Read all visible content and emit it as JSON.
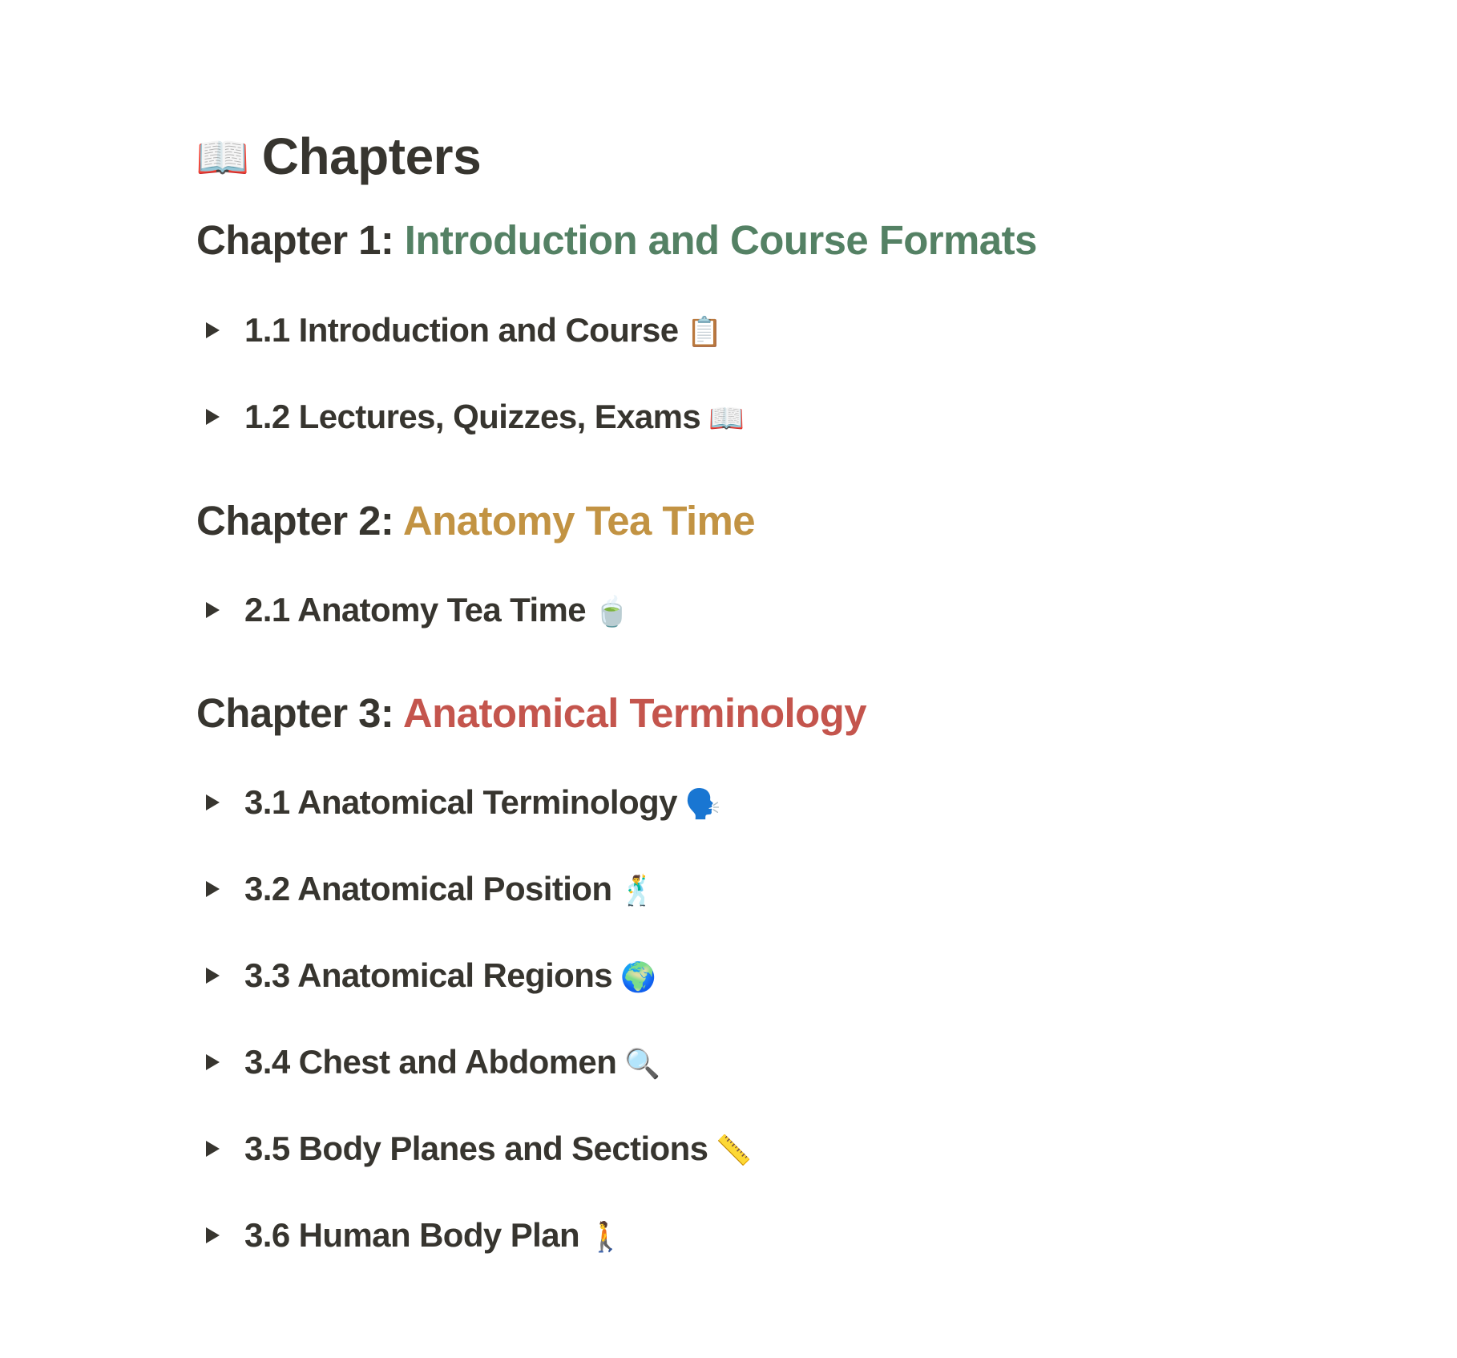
{
  "page": {
    "title": "Chapters",
    "title_icon": "📖",
    "title_icon_name": "open-book-icon"
  },
  "chapters": [
    {
      "prefix": "Chapter 1:  ",
      "name": "Introduction and Course Formats",
      "color": "#548164",
      "items": [
        {
          "label": "1.1 Introduction and Course",
          "emoji": "📋",
          "emoji_name": "clipboard-icon"
        },
        {
          "label": "1.2 Lectures, Quizzes, Exams",
          "emoji": "📖",
          "emoji_name": "open-book-icon"
        }
      ]
    },
    {
      "prefix": "Chapter 2: ",
      "name": "Anatomy Tea Time",
      "color": "#C29343",
      "items": [
        {
          "label": "2.1 Anatomy Tea Time",
          "emoji": "🍵",
          "emoji_name": "teacup-icon"
        }
      ]
    },
    {
      "prefix": "Chapter 3: ",
      "name": "Anatomical Terminology",
      "color": "#C4554D",
      "items": [
        {
          "label": "3.1 Anatomical Terminology",
          "emoji": "🗣️",
          "emoji_name": "speaking-head-icon"
        },
        {
          "label": "3.2 Anatomical Position",
          "emoji": "🕺",
          "emoji_name": "man-dancing-icon"
        },
        {
          "label": "3.3 Anatomical Regions",
          "emoji": "🌍",
          "emoji_name": "globe-icon"
        },
        {
          "label": "3.4 Chest and Abdomen ",
          "emoji": "🔍",
          "emoji_name": "magnifying-glass-icon"
        },
        {
          "label": "3.5 Body Planes and Sections",
          "emoji": "📏",
          "emoji_name": "ruler-icon"
        },
        {
          "label": "3.6 Human Body Plan",
          "emoji": "🚶",
          "emoji_name": "person-walking-icon"
        }
      ]
    }
  ],
  "text_color": "#37352F"
}
